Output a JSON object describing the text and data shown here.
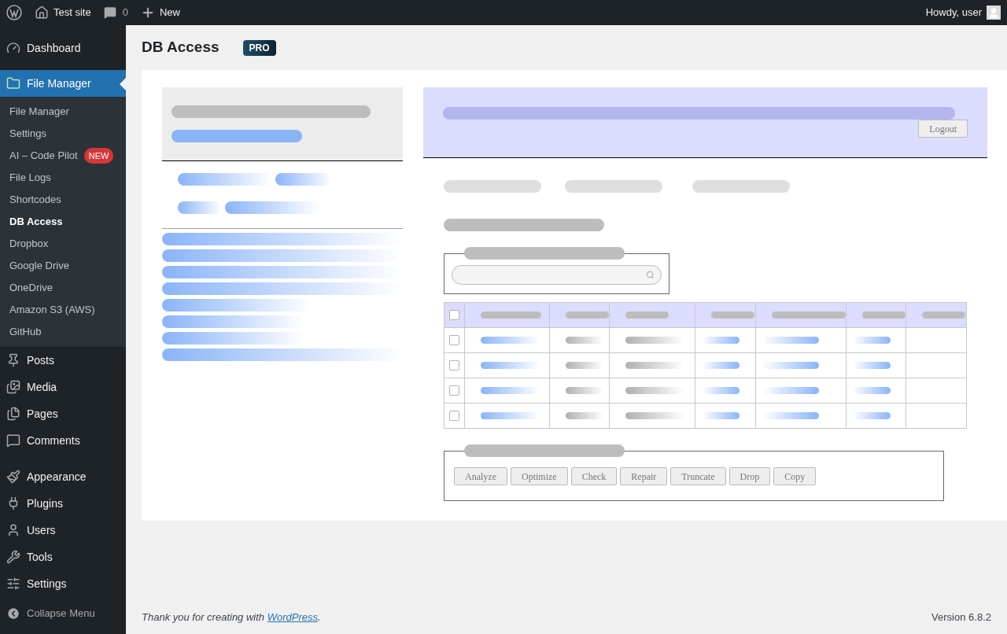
{
  "admin_bar": {
    "site": "Test site",
    "comments": "0",
    "new": "New",
    "greeting": "Howdy, user"
  },
  "menu_groups": [
    {
      "items": [
        {
          "label": "Dashboard",
          "selected": false
        },
        {
          "label": "File Manager",
          "selected": true
        }
      ]
    },
    {
      "items": [
        {
          "label": "Posts",
          "selected": false
        },
        {
          "label": "Media",
          "selected": false
        },
        {
          "label": "Pages",
          "selected": false
        },
        {
          "label": "Comments",
          "selected": false
        }
      ]
    },
    {
      "items": [
        {
          "label": "Appearance",
          "selected": false
        },
        {
          "label": "Plugins",
          "selected": false
        },
        {
          "label": "Users",
          "selected": false
        },
        {
          "label": "Tools",
          "selected": false
        },
        {
          "label": "Settings",
          "selected": false
        }
      ]
    }
  ],
  "submenu": [
    {
      "label": "File Manager",
      "selected": false
    },
    {
      "label": "Settings",
      "selected": false
    },
    {
      "label": "AI – Code Pilot",
      "selected": false,
      "badge": "NEW"
    },
    {
      "label": "File Logs",
      "selected": false
    },
    {
      "label": "Shortcodes",
      "selected": false
    },
    {
      "label": "DB Access",
      "selected": true
    },
    {
      "label": "Dropbox",
      "selected": false
    },
    {
      "label": "Google Drive",
      "selected": false
    },
    {
      "label": "OneDrive",
      "selected": false
    },
    {
      "label": "Amazon S3 (AWS)",
      "selected": false
    },
    {
      "label": "GitHub",
      "selected": false
    }
  ],
  "collapse": "Collapse Menu",
  "page": {
    "title": "DB Access",
    "badge": "PRO"
  },
  "logout": "Logout",
  "table": {
    "header_checked": false,
    "rows": [
      {
        "checked": false
      },
      {
        "checked": false
      },
      {
        "checked": false
      },
      {
        "checked": false
      }
    ]
  },
  "actions": [
    "Analyze",
    "Optimize",
    "Check",
    "Repair",
    "Truncate",
    "Drop",
    "Copy"
  ],
  "footer": {
    "before": "Thank you for creating with",
    "link": "WordPress",
    "after": ".",
    "version": "Version 6.8.2"
  }
}
